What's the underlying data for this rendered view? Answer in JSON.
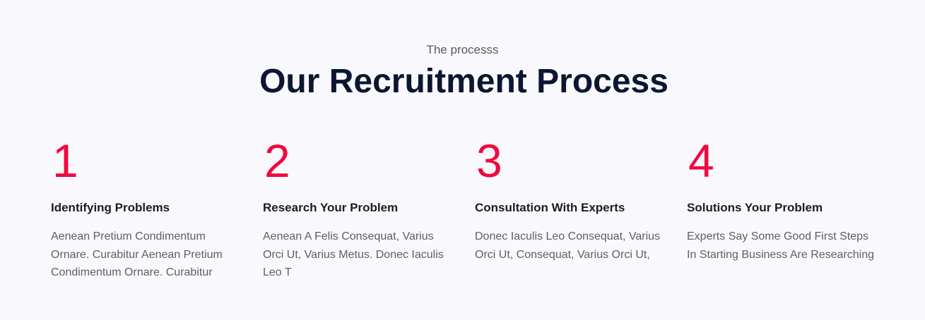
{
  "section": {
    "eyebrow": "The processs",
    "title": "Our Recruitment Process"
  },
  "steps": [
    {
      "number": "1",
      "title": "Identifying Problems",
      "text": "Aenean Pretium Condimentum Ornare. Curabitur Aenean Pretium Condimentum Ornare. Curabitur"
    },
    {
      "number": "2",
      "title": "Research Your Problem",
      "text": "Aenean A Felis Consequat, Varius Orci Ut, Varius Metus. Donec Iaculis Leo T"
    },
    {
      "number": "3",
      "title": "Consultation With Experts",
      "text": "Donec Iaculis Leo Consequat, Varius Orci Ut, Consequat, Varius Orci Ut,"
    },
    {
      "number": "4",
      "title": "Solutions Your Problem",
      "text": "Experts Say Some Good First Steps In Starting Business Are Researching"
    }
  ],
  "colors": {
    "accent": "#f0093f",
    "heading": "#0b1730",
    "background": "#f9f8fd"
  }
}
